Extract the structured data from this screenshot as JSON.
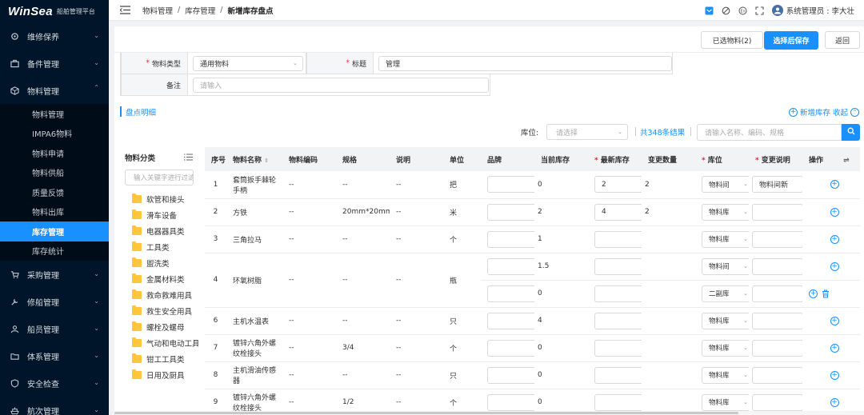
{
  "app": {
    "brand": "WinSea",
    "subtitle": "船舶管理平台"
  },
  "sidebar": {
    "items": [
      {
        "label": "维修保养",
        "icon": "gear-icon"
      },
      {
        "label": "备件管理",
        "icon": "briefcase-icon"
      },
      {
        "label": "物料管理",
        "icon": "cube-icon"
      },
      {
        "label": "采购管理",
        "icon": "cart-icon"
      },
      {
        "label": "修船管理",
        "icon": "wrench-icon"
      },
      {
        "label": "船员管理",
        "icon": "people-icon"
      },
      {
        "label": "体系管理",
        "icon": "folder-icon"
      },
      {
        "label": "安全检查",
        "icon": "shield-icon"
      },
      {
        "label": "航次管理",
        "icon": "ship-icon"
      }
    ],
    "sub_items": [
      {
        "label": "物料管理"
      },
      {
        "label": "IMPA6物料"
      },
      {
        "label": "物料申请"
      },
      {
        "label": "物料供船"
      },
      {
        "label": "质量反馈"
      },
      {
        "label": "物料出库"
      },
      {
        "label": "库存管理"
      },
      {
        "label": "库存统计"
      }
    ]
  },
  "header": {
    "breadcrumb": [
      "物料管理",
      "库存管理",
      "新增库存盘点"
    ],
    "user": "系统管理员 : 李大壮"
  },
  "actions": {
    "selected": "已选物料(2)",
    "save": "选择后保存",
    "back": "返回"
  },
  "form": {
    "type_label": "物料类型",
    "type_value": "通用物料",
    "title_label": "标题",
    "title_value": "管理",
    "remark_label": "备注",
    "remark_placeholder": "请输入"
  },
  "section": {
    "title": "盘点明细",
    "add": "新增库存",
    "collapse": "收起"
  },
  "filter": {
    "location_label": "库位:",
    "location_placeholder": "请选择",
    "count": "共348条结果",
    "search_placeholder": "请输入名称、编码、规格"
  },
  "categories": {
    "title": "物料分类",
    "search_placeholder": "输入关键字进行过滤",
    "items": [
      "软管和接头",
      "滑车设备",
      "电器器具类",
      "工具类",
      "盥洗类",
      "金属材料类",
      "救命救难用具",
      "救生安全用具",
      "螺栓及螺母",
      "气动和电动工具",
      "钳工工具类",
      "日用及厨具"
    ]
  },
  "table": {
    "headers": {
      "no": "序号",
      "name": "物料名称",
      "code": "物料编码",
      "spec": "规格",
      "desc": "说明",
      "unit": "单位",
      "brand": "品牌",
      "current": "当前库存",
      "latest": "最新库存",
      "change": "变更数量",
      "location": "库位",
      "change_desc": "变更说明",
      "ops": "操作"
    },
    "rows": [
      {
        "no": "1",
        "name": "套筒扳手棘轮手柄",
        "code": "--",
        "spec": "--",
        "desc": "--",
        "unit": "把",
        "subs": [
          {
            "current": "0",
            "latest": "2",
            "change": "2",
            "location": "物料间",
            "note": "物料间新"
          }
        ]
      },
      {
        "no": "2",
        "name": "方铁",
        "code": "--",
        "spec": "20mm*20mm",
        "desc": "--",
        "unit": "米",
        "subs": [
          {
            "current": "2",
            "latest": "4",
            "change": "2",
            "location": "物料库",
            "note": ""
          }
        ]
      },
      {
        "no": "3",
        "name": "三角拉马",
        "code": "--",
        "spec": "--",
        "desc": "--",
        "unit": "个",
        "subs": [
          {
            "current": "1",
            "latest": "",
            "change": "",
            "location": "物料库",
            "note": ""
          }
        ]
      },
      {
        "no": "4",
        "name": "环氧树脂",
        "code": "--",
        "spec": "--",
        "desc": "--",
        "unit": "瓶",
        "subs": [
          {
            "current": "1.5",
            "latest": "",
            "change": "",
            "location": "物料间",
            "note": ""
          },
          {
            "current": "0",
            "latest": "",
            "change": "",
            "location": "二副库",
            "note": ""
          }
        ]
      },
      {
        "no": "6",
        "name": "主机水温表",
        "code": "--",
        "spec": "--",
        "desc": "--",
        "unit": "只",
        "subs": [
          {
            "current": "4",
            "latest": "",
            "change": "",
            "location": "物料库",
            "note": ""
          }
        ]
      },
      {
        "no": "7",
        "name": "镀锌六角外螺纹栓接头",
        "code": "--",
        "spec": "3/4",
        "desc": "--",
        "unit": "个",
        "subs": [
          {
            "current": "0",
            "latest": "",
            "change": "",
            "location": "物料库",
            "note": ""
          }
        ]
      },
      {
        "no": "8",
        "name": "主机滑油传感器",
        "code": "--",
        "spec": "--",
        "desc": "--",
        "unit": "只",
        "subs": [
          {
            "current": "0",
            "latest": "",
            "change": "",
            "location": "物料库",
            "note": ""
          }
        ]
      },
      {
        "no": "9",
        "name": "镀锌六角外螺纹栓接头",
        "code": "--",
        "spec": "1/2",
        "desc": "--",
        "unit": "个",
        "subs": [
          {
            "current": "0",
            "latest": "",
            "change": "",
            "location": "物料库",
            "note": ""
          }
        ]
      }
    ]
  },
  "colors": {
    "primary": "#1890ff",
    "sidebar": "#001529",
    "danger": "#f5222d",
    "folder": "#ffc53d"
  }
}
